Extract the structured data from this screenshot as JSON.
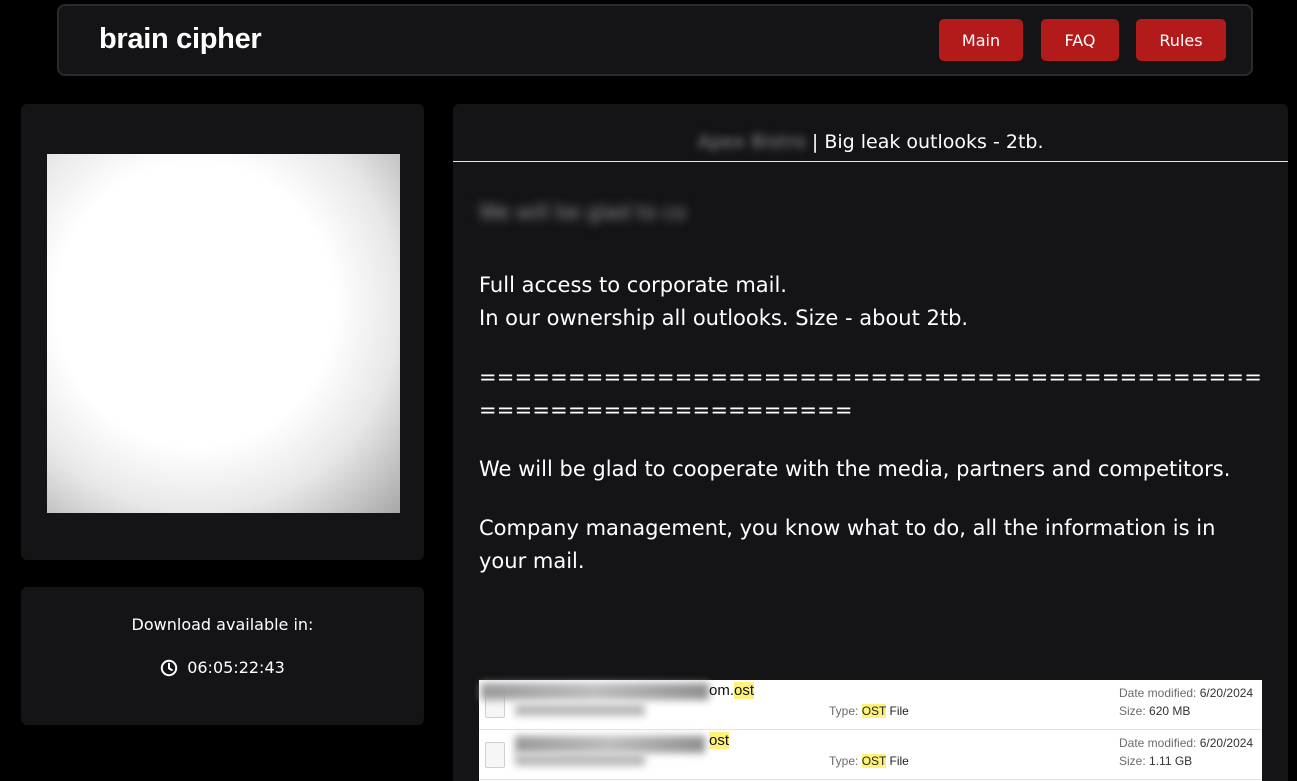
{
  "header": {
    "brand": "brain cipher",
    "nav": {
      "main": "Main",
      "faq": "FAQ",
      "rules": "Rules"
    }
  },
  "sidebar": {
    "download_label": "Download available in:",
    "countdown": "06:05:22:43"
  },
  "post": {
    "company_blurred": "Apex Bistro",
    "title": "Big leak outlooks - 2tb.",
    "intro_blurred": "We will be glad to co",
    "line1": "Full access to corporate mail.",
    "line2": "In our ownership all outlooks. Size - about 2tb.",
    "separator": "=================================================================",
    "para2": "We will be glad to cooperate with the media, partners and competitors.",
    "para3": "Company management, you know what to do, all the information is in your mail."
  },
  "files": [
    {
      "name_suffix_plain": "om.",
      "name_ext": "ost",
      "type_label": "Type:",
      "type_ext": "OST",
      "type_word": "File",
      "date_label": "Date modified:",
      "date": "6/20/2024",
      "size_label": "Size:",
      "size": "620 MB"
    },
    {
      "name_suffix_plain": "",
      "name_ext": "ost",
      "type_label": "Type:",
      "type_ext": "OST",
      "type_word": "File",
      "date_label": "Date modified:",
      "date": "6/20/2024",
      "size_label": "Size:",
      "size": "1.11 GB"
    }
  ],
  "icons": {
    "clock": "clock-icon",
    "file": "file-icon"
  }
}
